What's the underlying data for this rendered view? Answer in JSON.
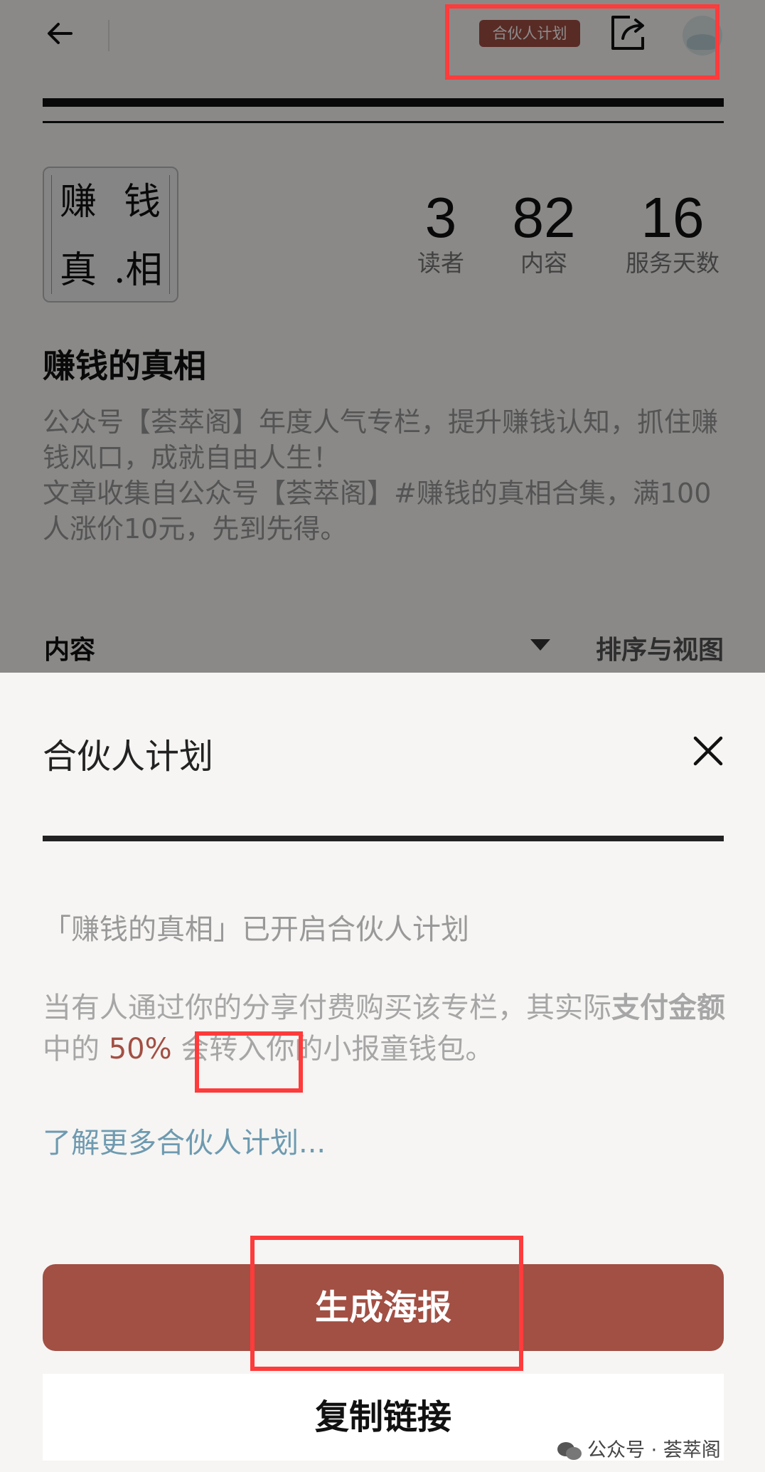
{
  "header": {
    "partner_badge": "合伙人计划"
  },
  "column": {
    "cover": {
      "char1": "赚",
      "char2": "钱",
      "char3": "真",
      "char4": ".相"
    },
    "stats": [
      {
        "value": "3",
        "label": "读者"
      },
      {
        "value": "82",
        "label": "内容"
      },
      {
        "value": "16",
        "label": "服务天数"
      }
    ],
    "title": "赚钱的真相",
    "description": [
      "公众号【荟萃阁】年度人气专栏，提升赚钱认知，抓住赚钱风口，成就自由人生！",
      "文章收集自公众号【荟萃阁】#赚钱的真相合集，满100人涨价10元，先到先得。"
    ],
    "content_label": "内容",
    "sort_label": "排序与视图"
  },
  "sheet": {
    "title": "合伙人计划",
    "enabled_text": "「赚钱的真相」已开启合伙人计划",
    "share_desc": {
      "part1": "当有人通过你的分享付费购买该专栏，其实际",
      "bold": "支付金额",
      "part2": "中的",
      "percent": "50%",
      "part3": "会转入你的小报童钱包。"
    },
    "learn_more": "了解更多合伙人计划...",
    "poster_button": "生成海报",
    "copy_button": "复制链接"
  },
  "watermark": "公众号 · 荟萃阁",
  "colors": {
    "accent": "#a24f44",
    "link": "#6e9ab0",
    "highlight": "#ff3b3b"
  }
}
